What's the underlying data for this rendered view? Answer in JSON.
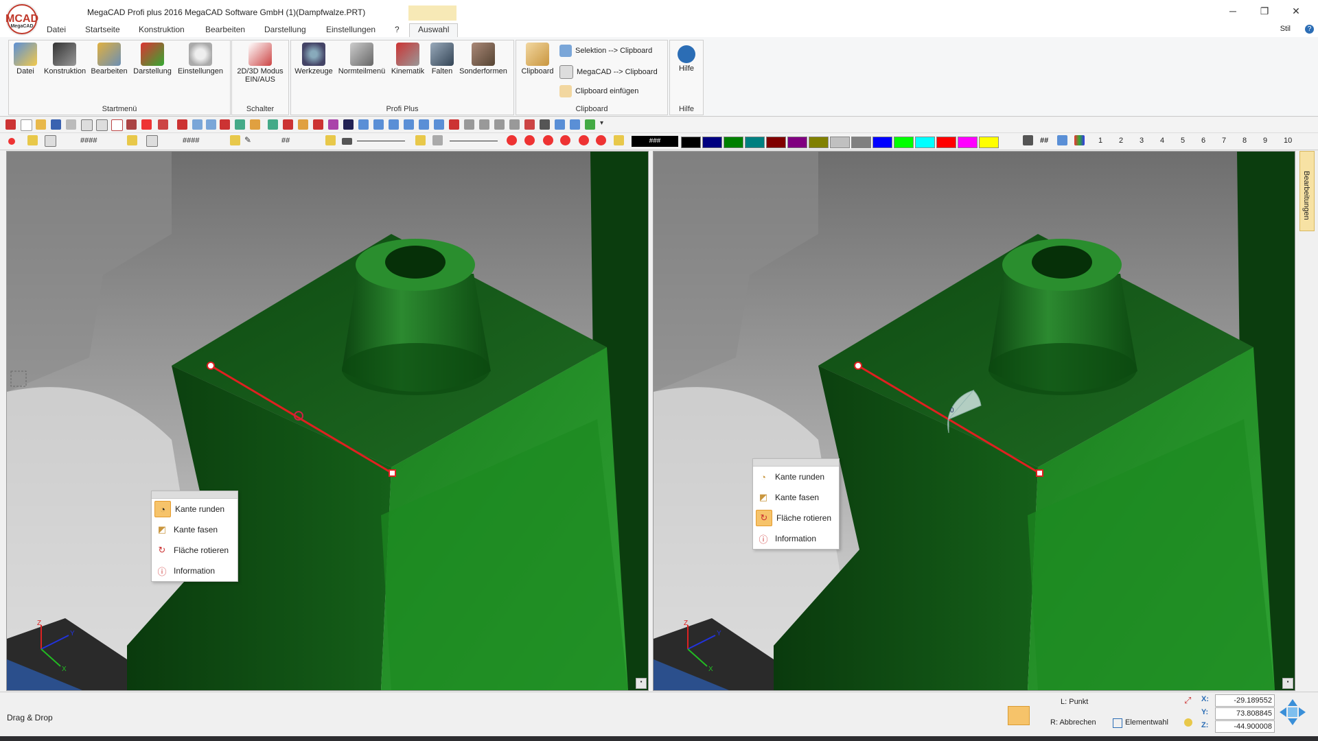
{
  "window": {
    "title": "MegaCAD Profi plus 2016  MegaCAD Software GmbH (1)(Dampfwalze.PRT)",
    "logo_text": "MCAD",
    "logo_sub": "MegaCAD",
    "context_tab_header": "",
    "minimize": "─",
    "maximize": "❐",
    "close": "✕"
  },
  "menu": {
    "tabs": [
      "Datei",
      "Startseite",
      "Konstruktion",
      "Bearbeiten",
      "Darstellung",
      "Einstellungen",
      "?",
      "Auswahl"
    ],
    "active_tab": "Auswahl",
    "stil": "Stil",
    "help": "?"
  },
  "ribbon": {
    "groups": {
      "startmenu": {
        "label": "Startmenü",
        "buttons": [
          "Datei",
          "Konstruktion",
          "Bearbeiten",
          "Darstellung",
          "Einstellungen"
        ]
      },
      "schalter": {
        "label": "Schalter",
        "button_line1": "2D/3D Modus",
        "button_line2": "EIN/AUS"
      },
      "profiplus": {
        "label": "Profi Plus",
        "buttons": [
          "Werkzeuge",
          "Normteilmenü",
          "Kinematik",
          "Falten",
          "Sonderformen"
        ]
      },
      "clipboard": {
        "label": "Clipboard",
        "big_button": "Clipboard",
        "items": [
          "Selektion --> Clipboard",
          "MegaCAD --> Clipboard",
          "Clipboard einfügen"
        ]
      },
      "hilfe": {
        "label": "Hilfe",
        "button": "Hilfe"
      }
    }
  },
  "toolbar2": {
    "field1": "####",
    "field2": "####",
    "field3": "##",
    "color_field": "###",
    "grid_label": "##",
    "layers": [
      "1",
      "2",
      "3",
      "4",
      "5",
      "6",
      "7",
      "8",
      "9",
      "10"
    ],
    "colors": [
      "#000000",
      "#000080",
      "#008000",
      "#008080",
      "#800000",
      "#800080",
      "#808000",
      "#c0c0c0",
      "#808080",
      "#0000ff",
      "#00ff00",
      "#00ffff",
      "#ff0000",
      "#ff00ff",
      "#ffff00"
    ]
  },
  "viewports": {
    "left": {
      "context_menu": [
        "Kante runden",
        "Kante fasen",
        "Fläche rotieren",
        "Information"
      ],
      "highlighted": 0
    },
    "right": {
      "context_menu": [
        "Kante runden",
        "Kante fasen",
        "Fläche rotieren",
        "Information"
      ],
      "highlighted": 2,
      "protractor_value": "0"
    },
    "axis_labels": [
      "Z",
      "Y",
      "X"
    ]
  },
  "side_tab": "Bearbeitungen",
  "status": {
    "mode": "Drag & Drop",
    "left_click": "L: Punkt",
    "right_click": "R: Abbrechen",
    "element_select": "Elementwahl",
    "x_label": "X:",
    "y_label": "Y:",
    "z_label": "Z:",
    "x": "-29.189552",
    "y": "73.808845",
    "z": "-44.900008"
  }
}
